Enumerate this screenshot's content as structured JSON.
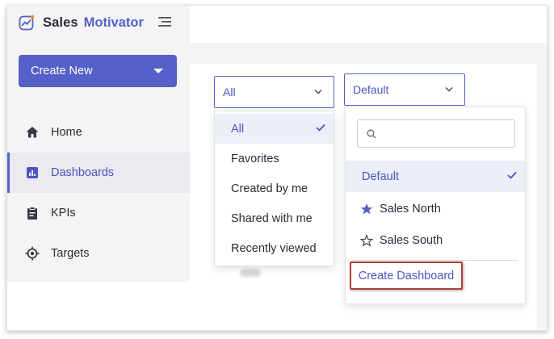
{
  "brand": {
    "name_part1": "Sales",
    "name_part2": "Motivator"
  },
  "sidebar": {
    "create_label": "Create New",
    "items": [
      {
        "label": "Home",
        "icon": "home-icon"
      },
      {
        "label": "Dashboards",
        "icon": "dashboard-icon",
        "active": true
      },
      {
        "label": "KPIs",
        "icon": "clipboard-icon"
      },
      {
        "label": "Targets",
        "icon": "target-icon"
      }
    ]
  },
  "filter_select": {
    "value": "All",
    "options": [
      {
        "label": "All",
        "selected": true
      },
      {
        "label": "Favorites"
      },
      {
        "label": "Created by me"
      },
      {
        "label": "Shared with me"
      },
      {
        "label": "Recently viewed"
      }
    ]
  },
  "dashboard_select": {
    "value": "Default",
    "search_placeholder": "",
    "options": [
      {
        "label": "Default",
        "selected": true,
        "icon": null
      },
      {
        "label": "Sales North",
        "icon": "star-filled-icon"
      },
      {
        "label": "Sales South",
        "icon": "star-outline-icon"
      }
    ],
    "create_label": "Create Dashboard"
  },
  "colors": {
    "accent": "#5560c8",
    "highlight_border": "#b0413b",
    "sidebar_bg": "#f4f4f6"
  }
}
